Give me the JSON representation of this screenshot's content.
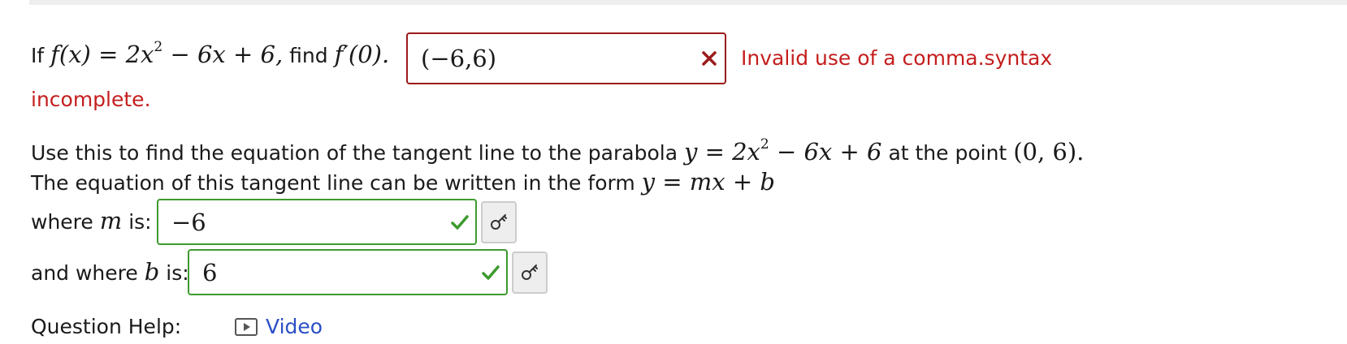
{
  "question": {
    "part1_prefix": "If",
    "function_math": "f(x) = 2x",
    "function_exp": "2",
    "function_tail": " − 6x + 6,",
    "find_word": "find",
    "derivative_math": "f′(0).",
    "answer1_value": "(−6,6)",
    "answer1_status": "incorrect",
    "error_message_line1": "Invalid use of a comma.syntax",
    "error_message_line2": "incomplete.",
    "intro_text": "Use this to find the equation of the tangent line to the parabola",
    "parabola_math": "y = 2x",
    "parabola_exp": "2",
    "parabola_tail": " − 6x + 6",
    "at_point_text": "at the point",
    "point_math": "(0, 6).",
    "form_text": "The equation of this tangent line can be written in the form",
    "form_math": "y = mx + b",
    "slope_label_prefix": "where",
    "slope_var": "m",
    "slope_label_suffix": "is:",
    "slope_value": "−6",
    "slope_status": "correct",
    "intercept_label_prefix": "and where",
    "intercept_var": "b",
    "intercept_label_suffix": "is:",
    "intercept_value": "6",
    "intercept_status": "correct",
    "help_label": "Question Help:",
    "help_link": "Video"
  },
  "icons": [
    "x-mark-icon",
    "check-mark-icon",
    "key-icon",
    "video-icon"
  ],
  "colors": {
    "error": "#c41e1e",
    "error_border": "#9b1b1b",
    "correct": "#3d9a2e",
    "link": "#2a4fc6"
  }
}
